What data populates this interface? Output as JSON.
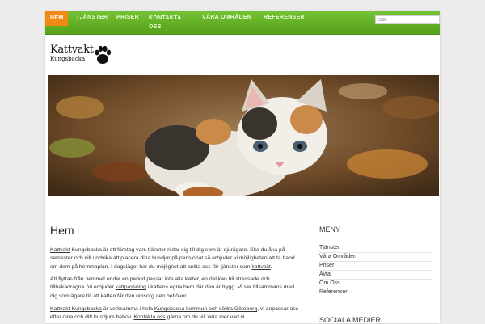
{
  "nav": {
    "items": [
      {
        "label": "Hem",
        "active": true
      },
      {
        "label": "Tjänster"
      },
      {
        "label": "Priser"
      },
      {
        "label": "Kontakta oss"
      },
      {
        "label": "Våra områden"
      },
      {
        "label": "Referenser"
      }
    ]
  },
  "search": {
    "placeholder": "Sök"
  },
  "logo": {
    "title": "Kattvakt",
    "subtitle": "Kungsbacka"
  },
  "content": {
    "title": "Hem",
    "p1": {
      "link1": "Kattvakt",
      "text1": " Kungsbacka är ett företag vars tjänster riktar sig till dig som är djurägare. Ska du åka på semester och vill undvika att placera dina husdjur på pensionat så erbjuder vi möjligheten att ta hand om dem på hemmaplan. I dagsläget har du möjlighet att anlita oss för tjänster som ",
      "link2": "kattvakt",
      "text2": "."
    },
    "p2": {
      "text1": "Att flyttas från hemmet under en period passar inte alla katter, en del kan bli stressade och tillbakadragna. Vi erbjuder ",
      "link1": "kattpassning",
      "text2": " i kattens egna hem där den är trygg. Vi ser tillsammans med dig som ägare till att katten får den omsorg den behöver."
    },
    "p3": {
      "link1": "Kattvakt Kungsbacka",
      "text1": " är verksamma i hela ",
      "link2": "Kungsbacka kommun och södra Göteborg",
      "text2": ", vi anpassar oss efter dina och ditt husdjurs behov. ",
      "link3": "Kontakta oss",
      "text3": " gärna om du vill veta mer vad vi"
    }
  },
  "sidebar": {
    "menu_title": "MENY",
    "items": [
      "Tjänster",
      "Våra Områden",
      "Priser",
      "Avtal",
      "Om Oss",
      "Referenser"
    ],
    "social_title": "SOCIALA MEDIER"
  },
  "colors": {
    "nav_green": "#5fae22",
    "active_orange": "#f18a12"
  }
}
